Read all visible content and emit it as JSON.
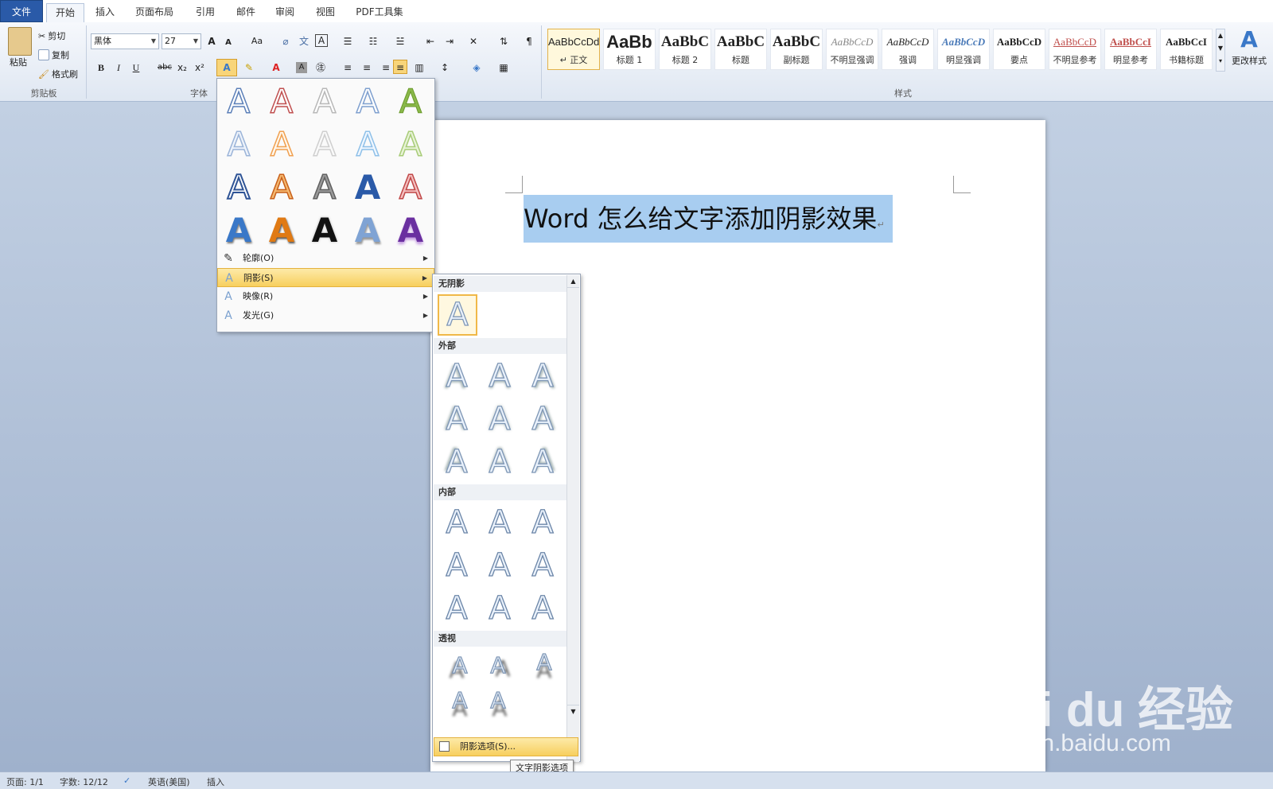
{
  "tabs": [
    {
      "label": "文件"
    },
    {
      "label": "开始"
    },
    {
      "label": "插入"
    },
    {
      "label": "页面布局"
    },
    {
      "label": "引用"
    },
    {
      "label": "邮件"
    },
    {
      "label": "审阅"
    },
    {
      "label": "视图"
    },
    {
      "label": "PDF工具集"
    }
  ],
  "clipboard": {
    "paste": "粘贴",
    "cut": "剪切",
    "copy": "复制",
    "format_painter": "格式刷",
    "group": "剪贴板"
  },
  "font": {
    "name": "黑体",
    "size": "27",
    "group": "字体",
    "bold": "B",
    "italic": "I",
    "underline": "U",
    "strike": "abc",
    "sub": "x₂",
    "sup": "x²",
    "grow": "A",
    "shrink": "A",
    "case": "Aa",
    "color_letter": "A"
  },
  "styles": {
    "group": "样式",
    "change_styles": "更改样式",
    "items": [
      {
        "preview": "AaBbCcDd",
        "name": "↵ 正文"
      },
      {
        "preview": "AaBb",
        "name": "标题 1"
      },
      {
        "preview": "AaBbC",
        "name": "标题 2"
      },
      {
        "preview": "AaBbC",
        "name": "标题"
      },
      {
        "preview": "AaBbC",
        "name": "副标题"
      },
      {
        "preview": "AaBbCcD",
        "name": "不明显强调"
      },
      {
        "preview": "AaBbCcD",
        "name": "强调"
      },
      {
        "preview": "AaBbCcD",
        "name": "明显强调"
      },
      {
        "preview": "AaBbCcD",
        "name": "要点"
      },
      {
        "preview": "AaBbCcD",
        "name": "不明显参考"
      },
      {
        "preview": "AaBbCcI",
        "name": "明显参考"
      },
      {
        "preview": "AaBbCcI",
        "name": "书籍标题"
      }
    ]
  },
  "document": {
    "title": "Word 怎么给文字添加阴影效果"
  },
  "effects_menu": {
    "letter": "A",
    "items": [
      {
        "label": "轮廓(O)"
      },
      {
        "label": "阴影(S)"
      },
      {
        "label": "映像(R)"
      },
      {
        "label": "发光(G)"
      }
    ]
  },
  "shadow_menu": {
    "no_shadow": "无阴影",
    "outer": "外部",
    "inner": "内部",
    "perspective": "透视",
    "options": "阴影选项(S)...",
    "tooltip": "文字阴影选项"
  },
  "status": {
    "page": "页面: 1/1",
    "words": "字数: 12/12",
    "language": "英语(美国)",
    "mode": "插入"
  },
  "watermark": {
    "brand": "Bai du 经验",
    "url": "jingyan.baidu.com"
  },
  "colors": {
    "accent": "#2a5aa8",
    "highlight": "#a8cdf0",
    "menu_hover": "#f7cf5e"
  }
}
